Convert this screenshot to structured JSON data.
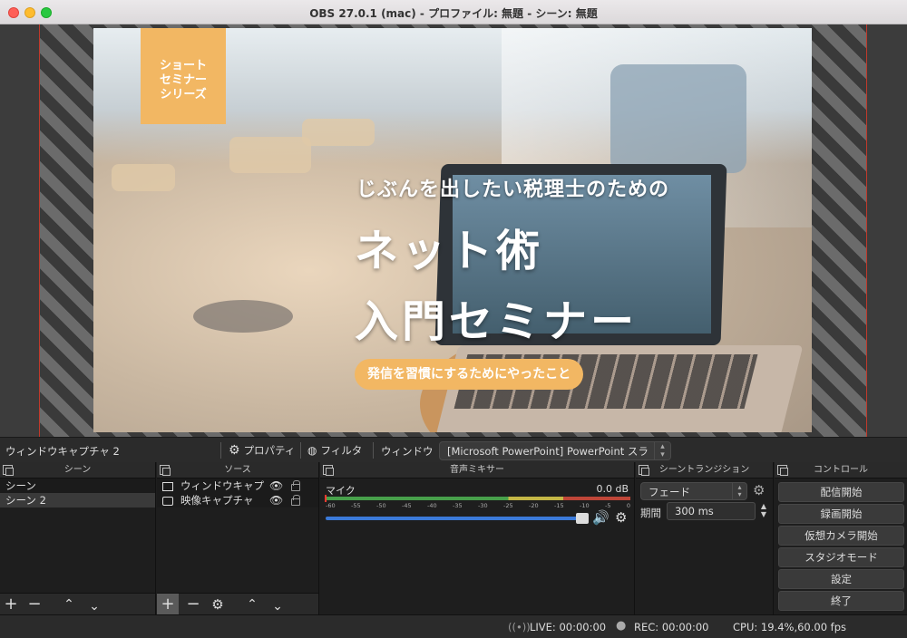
{
  "window": {
    "title": "OBS 27.0.1 (mac) - プロファイル: 無題 - シーン: 無題"
  },
  "preview": {
    "badge_lines": [
      "ショート",
      "セミナー",
      "シリーズ"
    ],
    "headline_small": "じぶんを出したい税理士のための",
    "headline_line1": "ネット術",
    "headline_line2": "入門セミナー",
    "pill_text": "発信を習慣にするためにやったこと",
    "colors": {
      "accent_orange": "#f2b763",
      "selection_red": "#c0392b"
    }
  },
  "source_bar": {
    "selected_source": "ウィンドウキャプチャ 2",
    "properties_label": "プロパティ",
    "filters_label": "フィルタ",
    "window_label": "ウィンドウ",
    "window_value": "[Microsoft PowerPoint] PowerPoint スラ"
  },
  "scenes": {
    "title": "シーン",
    "items": [
      {
        "label": "シーン",
        "selected": false
      },
      {
        "label": "シーン 2",
        "selected": true
      }
    ]
  },
  "sources": {
    "title": "ソース",
    "items": [
      {
        "label": "ウィンドウキャプ",
        "icon": "window-icon"
      },
      {
        "label": "映像キャプチャ",
        "icon": "camera-icon"
      }
    ]
  },
  "mixer": {
    "title": "音声ミキサー",
    "channel": "マイク",
    "db_value": "0.0 dB",
    "volume_fraction": 0.97,
    "ticks": [
      "-60",
      "-55",
      "-50",
      "-45",
      "-40",
      "-35",
      "-30",
      "-25",
      "-20",
      "-15",
      "-10",
      "-5",
      "0"
    ]
  },
  "transitions": {
    "title": "シーントランジション",
    "selected": "フェード",
    "duration_label": "期間",
    "duration_value": "300 ms"
  },
  "controls": {
    "title": "コントロール",
    "buttons": [
      "配信開始",
      "録画開始",
      "仮想カメラ開始",
      "スタジオモード",
      "設定",
      "終了"
    ]
  },
  "status": {
    "live": "LIVE: 00:00:00",
    "rec": "REC: 00:00:00",
    "cpu": "CPU: 19.4%,60.00 fps"
  }
}
